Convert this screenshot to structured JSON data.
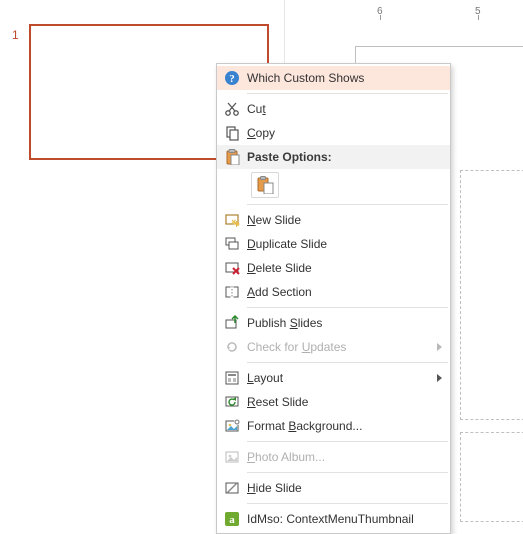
{
  "thumbnail": {
    "slide_number": "1"
  },
  "ruler": {
    "labels": [
      "6",
      "5"
    ]
  },
  "menu": {
    "which_custom_shows": "Which Custom Shows",
    "cut": "Cut",
    "copy": "Copy",
    "paste_options": "Paste Options:",
    "new_slide": "New Slide",
    "duplicate_slide": "Duplicate Slide",
    "delete_slide": "Delete Slide",
    "add_section": "Add Section",
    "publish_slides": "Publish Slides",
    "check_updates": "Check for Updates",
    "layout": "Layout",
    "reset_slide": "Reset Slide",
    "format_background": "Format Background...",
    "photo_album": "Photo Album...",
    "hide_slide": "Hide Slide",
    "idmso": "IdMso: ContextMenuThumbnail",
    "accel": {
      "cut": "t",
      "copy": "C",
      "new": "N",
      "duplicate": "D",
      "delete": "D",
      "add_section": "A",
      "publish": "S",
      "check": "U",
      "layout": "L",
      "reset": "R",
      "format": "B",
      "photo": "P",
      "hide": "H"
    }
  }
}
